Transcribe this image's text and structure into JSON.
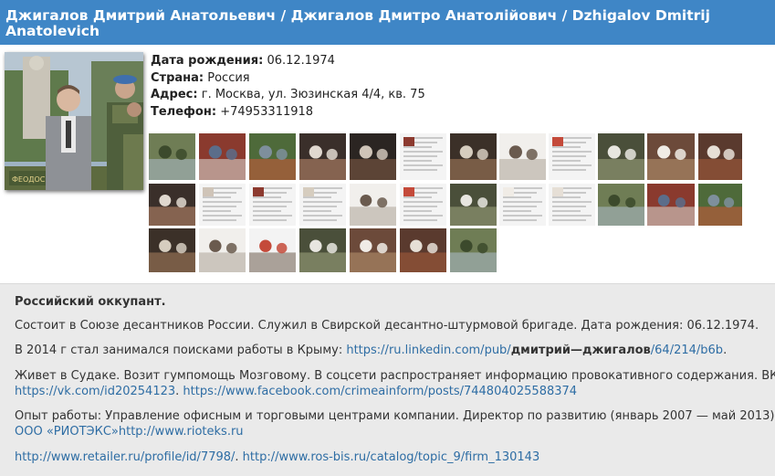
{
  "header": {
    "title_line1": "Джигалов Дмитрий Анатольевич / Джигалов Дмитро Анатолійович / Dzhigalov Dmitrij",
    "title_line2": "Anatolevich"
  },
  "profile": {
    "birth_label": "Дата рождения:",
    "birth_value": "06.12.1974",
    "country_label": "Страна:",
    "country_value": "Россия",
    "address_label": "Адрес:",
    "address_value": "г. Москва, ул. Зюзинская 4/4, кв. 75",
    "phone_label": "Телефон:",
    "phone_value": "+74953311918",
    "photo_caption": "ФЕОДОСИЙ"
  },
  "description": {
    "heading": "Российский оккупант.",
    "p1": "Состоит в Союзе десантников России. Служил в Свирской десантно-штурмовой бригаде. Дата рождения: 06.12.1974.",
    "p2_prefix": "В 2014 г стал занимался поисками работы в  Крыму: ",
    "p2_link_a": "https://ru.linkedin.com/pub/",
    "p2_link_b": "дмитрий—джигалов",
    "p2_link_c": "/64/214/b6b",
    "p2_suffix": ".",
    "p3_text": "Живет в Судаке. Возит гумпомощь Мозговому.  В соцсети распространяет  информацию провокативного содержания. ВК:",
    "p3_link1": "https://vk.com/id20254123",
    "p3_sep": ". ",
    "p3_link2": "https://www.facebook.com/crimeainform/posts/744804025588374",
    "p4_text": "Опыт работы: Управление офисным и торговыми центрами компании. Директор по развитию (январь 2007 — май 2013)",
    "p4_link": "ООО «РИОТЭКС»http://www.rioteks.ru",
    "p5_link1": "http://www.retailer.ru/profile/id/7798/",
    "p5_sep": ".  ",
    "p5_link2": "http://www.ros-bis.ru/catalog/topic_9/firm_130143"
  }
}
